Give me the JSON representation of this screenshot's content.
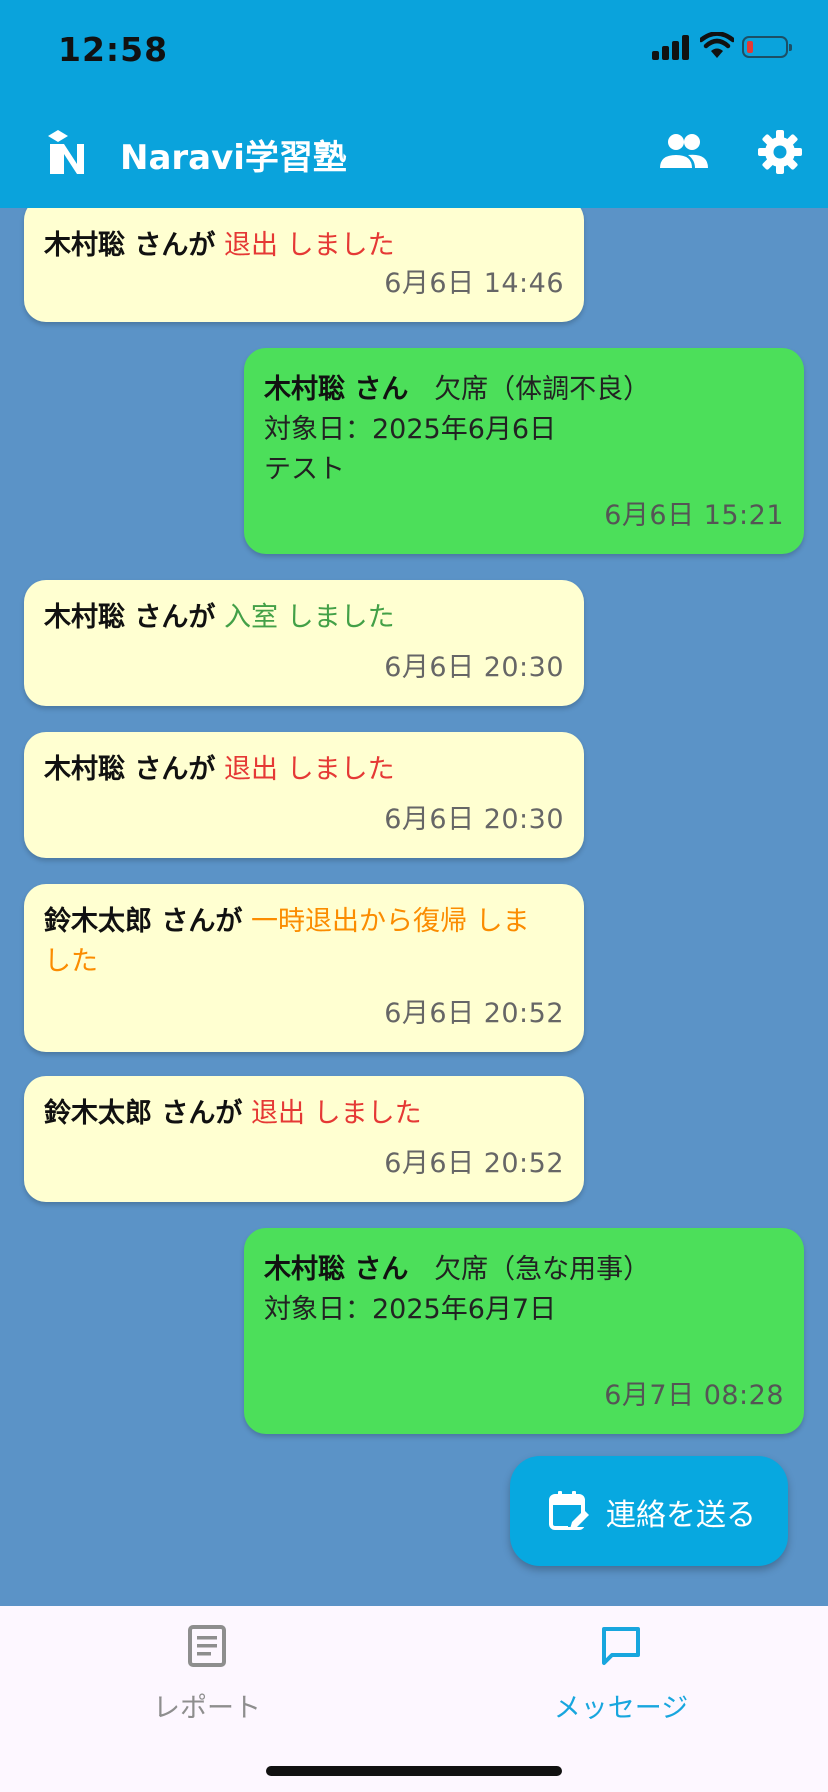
{
  "status_bar": {
    "time": "12:58"
  },
  "app_bar": {
    "title": "Naravi学習塾",
    "logo_icon": "naravi-logo-icon",
    "actions": [
      "people-icon",
      "gear-icon"
    ]
  },
  "messages": [
    {
      "side": "left",
      "name": "木村聡 さんが",
      "action": "退出 しました",
      "action_color": "#e53935",
      "timestamp": "6月6日 14:46"
    },
    {
      "side": "right",
      "header_name": "木村聡 さん",
      "header_status": "欠席（体調不良）",
      "target_date": "対象日：2025年6月6日",
      "note": "テスト",
      "timestamp": "6月6日 15:21"
    },
    {
      "side": "left",
      "name": "木村聡 さんが",
      "action": "入室 しました",
      "action_color": "#43a047",
      "timestamp": "6月6日 20:30"
    },
    {
      "side": "left",
      "name": "木村聡 さんが",
      "action": "退出 しました",
      "action_color": "#e53935",
      "timestamp": "6月6日 20:30"
    },
    {
      "side": "left",
      "name": "鈴木太郎 さんが",
      "action_line1": "一時退出から復帰 しま",
      "action_line2": "した",
      "action_color": "#fb8c00",
      "timestamp": "6月6日 20:52"
    },
    {
      "side": "left",
      "name": "鈴木太郎 さんが",
      "action": "退出 しました",
      "action_color": "#e53935",
      "timestamp": "6月6日 20:52"
    },
    {
      "side": "right",
      "header_name": "木村聡 さん",
      "header_status": "欠席（急な用事）",
      "target_date": "対象日：2025年6月7日",
      "timestamp": "6月7日 08:28"
    }
  ],
  "fab": {
    "label": "連絡を送る",
    "icon": "calendar-edit-icon"
  },
  "bottom_nav": {
    "items": [
      {
        "label": "レポート",
        "icon": "report-icon",
        "active": false
      },
      {
        "label": "メッセージ",
        "icon": "chat-icon",
        "active": true
      }
    ]
  },
  "colors": {
    "app_bar": "#0aa3dc",
    "background": "#5b93c7",
    "received_bubble": "#ffffd1",
    "sent_bubble": "#4cdf5a",
    "accent": "#18a6de"
  }
}
